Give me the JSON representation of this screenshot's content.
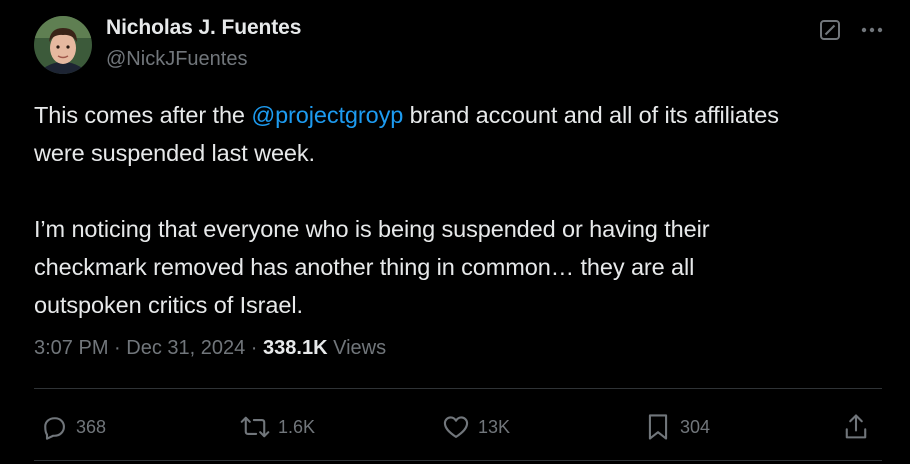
{
  "author": {
    "name": "Nicholas J. Fuentes",
    "handle": "@NickJFuentes"
  },
  "icons": {
    "grok": "grok-icon",
    "more": "more-dots-icon",
    "reply": "reply-icon",
    "repost": "repost-icon",
    "like": "heart-icon",
    "bookmark": "bookmark-icon",
    "share": "share-icon"
  },
  "body": {
    "p1_line1_pre": "This comes after the ",
    "mention": "@projectgroyp",
    "p1_line1_post": " brand account and all of its affiliates",
    "p1_line2": "were suspended last week.",
    "p2_line1": "I’m noticing that everyone who is being suspended or having their",
    "p2_line2": "checkmark removed has another thing in common… they are all",
    "p2_line3": "outspoken critics of Israel."
  },
  "meta": {
    "time": "3:07 PM",
    "sep1": " · ",
    "date": "Dec 31, 2024",
    "sep2": " · ",
    "views_count": "338.1K",
    "views_label": " Views"
  },
  "actions": {
    "replies": "368",
    "reposts": "1.6K",
    "likes": "13K",
    "bookmarks": "304"
  },
  "colors": {
    "background": "#000000",
    "text": "#e7e9ea",
    "secondary": "#71767b",
    "link": "#1d9bf0",
    "divider": "#2f3336"
  }
}
